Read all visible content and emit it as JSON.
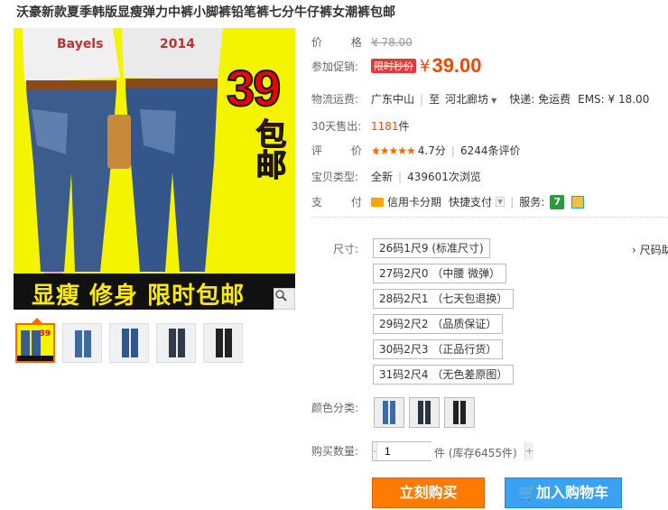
{
  "title": "沃豪新款夏季韩版显瘦弹力中裤小脚裤铅笔裤七分牛仔裤女潮裤包邮",
  "image": {
    "big_number": "39",
    "big_text": "包邮",
    "bottom_banner": "显瘦 修身 限时包邮",
    "shirt_text_left": "Bayels",
    "shirt_text_right": "2014",
    "thumb_badge": "39"
  },
  "price": {
    "label": "价 格:",
    "original": "¥ 78.00",
    "promo_label": "参加促销:",
    "promo_tag": "限时秒价",
    "currency": "¥",
    "current": "39.00"
  },
  "shipping": {
    "label": "物流运费:",
    "from": "广东中山",
    "to_prefix": "至",
    "to": "河北廊坊",
    "fee": "快递: 免运费",
    "ems": "EMS: ¥ 18.00"
  },
  "sales": {
    "label": "30天售出:",
    "count": "1181",
    "unit": "件"
  },
  "rating": {
    "label": "评 价:",
    "stars": "★★★★★",
    "score": "4.7分",
    "count": "6244条评价"
  },
  "type": {
    "label": "宝贝类型:",
    "value": "全新",
    "views": "439601次浏览"
  },
  "payment": {
    "label": "支 付:",
    "credit": "信用卡分期",
    "quick": "快捷支付",
    "service_label": "服务:",
    "service_badge": "7"
  },
  "sizes": {
    "label": "尺寸:",
    "chart_link": "尺码助",
    "options": [
      "26码1尺9 (标准尺寸)",
      "27码2尺0 （中腰 微弹）",
      "28码2尺1 （七天包退换）",
      "29码2尺2 （品质保证）",
      "30码2尺3 （正品行货）",
      "31码2尺4 （无色差原图）"
    ]
  },
  "color": {
    "label": "颜色分类:"
  },
  "quantity": {
    "label": "购买数量:",
    "value": "1",
    "minus": "-",
    "plus": "+",
    "note": "件 (库存6455件)"
  },
  "buttons": {
    "buy": "立刻购买",
    "cart": "加入购物车"
  },
  "colors": {
    "accent_price": "#ff4400",
    "buy_button": "#ff7a00",
    "cart_button": "#3aa1f3",
    "banner_bg": "#f4f400"
  }
}
